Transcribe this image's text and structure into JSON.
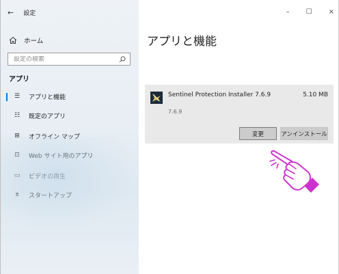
{
  "window": {
    "title": "設定",
    "controls": {
      "minimize": "–",
      "maximize": "☐",
      "close": "×"
    }
  },
  "sidebar": {
    "home_label": "ホーム",
    "search_placeholder": "設定の検索",
    "section_title": "アプリ",
    "items": [
      {
        "label": "アプリと機能",
        "icon": "apps-features-icon",
        "glyph": "☰",
        "active": true
      },
      {
        "label": "既定のアプリ",
        "icon": "default-apps-icon",
        "glyph": "☷",
        "active": false
      },
      {
        "label": "オフライン マップ",
        "icon": "offline-maps-icon",
        "glyph": "⊞",
        "active": false
      },
      {
        "label": "Web サイト用のアプリ",
        "icon": "websites-apps-icon",
        "glyph": "⊡",
        "active": false
      },
      {
        "label": "ビデオの再生",
        "icon": "video-playback-icon",
        "glyph": "▭",
        "active": false
      },
      {
        "label": "スタートアップ",
        "icon": "startup-icon",
        "glyph": "⌆",
        "active": false
      }
    ]
  },
  "main": {
    "title": "アプリと機能",
    "app": {
      "name": "Sentinel Protection Installer 7.6.9",
      "size": "5.10 MB",
      "version": "7.6.9",
      "buttons": {
        "change": "変更",
        "uninstall": "アンインストール"
      }
    }
  },
  "colors": {
    "accent": "#0078d7",
    "pointer_hand": "#cc33cc"
  }
}
